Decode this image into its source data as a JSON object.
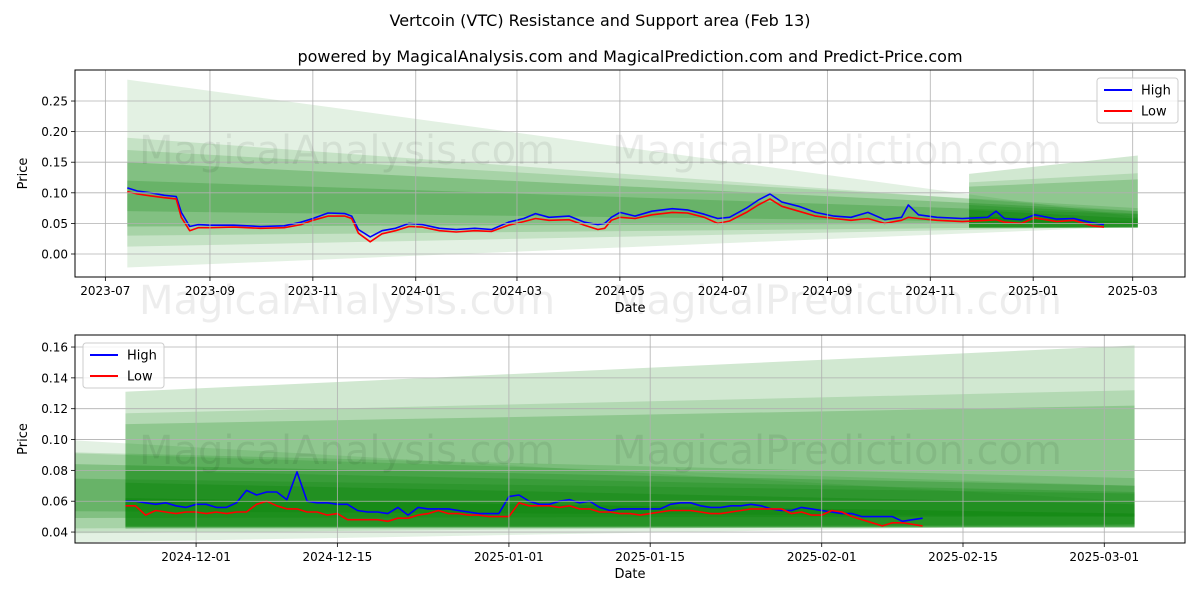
{
  "title": "Vertcoin (VTC) Resistance and Support area (Feb 13)",
  "subtitle": "powered by MagicalAnalysis.com and MagicalPrediction.com and Predict-Price.com",
  "watermarks": [
    "MagicalAnalysis.com",
    "MagicalPrediction.com"
  ],
  "colors": {
    "high": "#0000ff",
    "low": "#ff0000",
    "band": "#008000",
    "grid": "#b0b0b0"
  },
  "chart_data": [
    {
      "type": "line",
      "xlabel": "Date",
      "ylabel": "Price",
      "xlim": [
        "2023-06-13",
        "2025-04-01"
      ],
      "ylim": [
        -0.0376,
        0.3007
      ],
      "grid": true,
      "legend": "top-right",
      "xticks": [
        "2023-07",
        "2023-09",
        "2023-11",
        "2024-01",
        "2024-03",
        "2024-05",
        "2024-07",
        "2024-09",
        "2024-11",
        "2025-01",
        "2025-03"
      ],
      "yticks": [
        "0.00",
        "0.05",
        "0.10",
        "0.15",
        "0.20",
        "0.25"
      ],
      "bands": [
        {
          "start": "2023-07-14",
          "end": "2025-03-04",
          "lo": [
            -0.022,
            0.045
          ],
          "hi": [
            0.285,
            0.06
          ],
          "opacity": 0.11
        },
        {
          "start": "2023-07-14",
          "end": "2025-03-04",
          "lo": [
            0.012,
            0.045
          ],
          "hi": [
            0.19,
            0.07
          ],
          "opacity": 0.13
        },
        {
          "start": "2023-07-14",
          "end": "2025-03-04",
          "lo": [
            0.03,
            0.045
          ],
          "hi": [
            0.17,
            0.075
          ],
          "opacity": 0.15
        },
        {
          "start": "2023-07-14",
          "end": "2025-03-04",
          "lo": [
            0.045,
            0.05
          ],
          "hi": [
            0.15,
            0.07
          ],
          "opacity": 0.22
        },
        {
          "start": "2023-07-14",
          "end": "2025-03-04",
          "lo": [
            0.07,
            0.05
          ],
          "hi": [
            0.12,
            0.065
          ],
          "opacity": 0.2
        },
        {
          "start": "2024-11-24",
          "end": "2025-03-04",
          "lo": [
            0.042,
            0.043
          ],
          "hi": [
            0.131,
            0.161
          ],
          "opacity": 0.18
        },
        {
          "start": "2024-11-24",
          "end": "2025-03-04",
          "lo": [
            0.043,
            0.043
          ],
          "hi": [
            0.117,
            0.132
          ],
          "opacity": 0.14
        },
        {
          "start": "2024-11-24",
          "end": "2025-03-04",
          "lo": [
            0.043,
            0.043
          ],
          "hi": [
            0.11,
            0.122
          ],
          "opacity": 0.2
        },
        {
          "start": "2024-11-24",
          "end": "2025-03-04",
          "lo": [
            0.043,
            0.043
          ],
          "hi": [
            0.08,
            0.066
          ],
          "opacity": 0.2
        },
        {
          "start": "2024-11-24",
          "end": "2025-03-04",
          "lo": [
            0.043,
            0.043
          ],
          "hi": [
            0.072,
            0.058
          ],
          "opacity": 0.25
        },
        {
          "start": "2024-11-24",
          "end": "2025-03-04",
          "lo": [
            0.044,
            0.044
          ],
          "hi": [
            0.062,
            0.052
          ],
          "opacity": 0.3
        }
      ],
      "x": [
        "2023-07-14",
        "2023-07-20",
        "2023-07-28",
        "2023-08-05",
        "2023-08-12",
        "2023-08-15",
        "2023-08-20",
        "2023-08-25",
        "2023-09-01",
        "2023-09-15",
        "2023-10-01",
        "2023-10-15",
        "2023-10-25",
        "2023-11-01",
        "2023-11-10",
        "2023-11-20",
        "2023-11-24",
        "2023-11-28",
        "2023-12-05",
        "2023-12-12",
        "2023-12-20",
        "2023-12-28",
        "2024-01-05",
        "2024-01-15",
        "2024-01-25",
        "2024-02-05",
        "2024-02-15",
        "2024-02-25",
        "2024-03-05",
        "2024-03-12",
        "2024-03-20",
        "2024-04-01",
        "2024-04-10",
        "2024-04-18",
        "2024-04-22",
        "2024-04-26",
        "2024-05-01",
        "2024-05-10",
        "2024-05-20",
        "2024-06-01",
        "2024-06-10",
        "2024-06-20",
        "2024-06-28",
        "2024-07-05",
        "2024-07-15",
        "2024-07-22",
        "2024-07-29",
        "2024-08-05",
        "2024-08-15",
        "2024-08-25",
        "2024-09-05",
        "2024-09-15",
        "2024-09-25",
        "2024-10-05",
        "2024-10-15",
        "2024-10-19",
        "2024-10-25",
        "2024-11-05",
        "2024-11-20",
        "2024-12-05",
        "2024-12-10",
        "2024-12-15",
        "2024-12-25",
        "2025-01-02",
        "2025-01-15",
        "2025-01-25",
        "2025-02-05",
        "2025-02-12"
      ],
      "series": [
        {
          "name": "High",
          "values": [
            0.108,
            0.103,
            0.1,
            0.096,
            0.094,
            0.068,
            0.045,
            0.048,
            0.047,
            0.047,
            0.045,
            0.046,
            0.052,
            0.058,
            0.067,
            0.066,
            0.062,
            0.04,
            0.028,
            0.038,
            0.042,
            0.05,
            0.048,
            0.042,
            0.04,
            0.042,
            0.04,
            0.052,
            0.058,
            0.066,
            0.06,
            0.062,
            0.052,
            0.048,
            0.05,
            0.06,
            0.068,
            0.062,
            0.07,
            0.074,
            0.072,
            0.065,
            0.058,
            0.06,
            0.075,
            0.088,
            0.098,
            0.085,
            0.078,
            0.068,
            0.062,
            0.06,
            0.068,
            0.056,
            0.06,
            0.08,
            0.064,
            0.06,
            0.058,
            0.06,
            0.07,
            0.058,
            0.056,
            0.064,
            0.057,
            0.058,
            0.051,
            0.048
          ]
        },
        {
          "name": "Low",
          "values": [
            0.102,
            0.098,
            0.095,
            0.092,
            0.09,
            0.06,
            0.038,
            0.043,
            0.043,
            0.044,
            0.042,
            0.043,
            0.048,
            0.055,
            0.062,
            0.062,
            0.058,
            0.034,
            0.02,
            0.033,
            0.038,
            0.045,
            0.044,
            0.038,
            0.036,
            0.038,
            0.037,
            0.047,
            0.053,
            0.058,
            0.055,
            0.056,
            0.047,
            0.04,
            0.042,
            0.055,
            0.06,
            0.058,
            0.064,
            0.068,
            0.067,
            0.06,
            0.05,
            0.054,
            0.068,
            0.08,
            0.09,
            0.078,
            0.07,
            0.062,
            0.058,
            0.055,
            0.058,
            0.05,
            0.055,
            0.06,
            0.058,
            0.055,
            0.053,
            0.055,
            0.056,
            0.052,
            0.05,
            0.059,
            0.053,
            0.055,
            0.046,
            0.044
          ]
        }
      ]
    },
    {
      "type": "line",
      "xlabel": "Date",
      "ylabel": "Price",
      "xlim": [
        "2024-11-19",
        "2025-03-09"
      ],
      "ylim": [
        0.0329,
        0.1678
      ],
      "grid": true,
      "legend": "top-left",
      "xticks": [
        "2024-12-01",
        "2024-12-15",
        "2025-01-01",
        "2025-01-15",
        "2025-02-01",
        "2025-02-15",
        "2025-03-01"
      ],
      "yticks": [
        "0.04",
        "0.06",
        "0.08",
        "0.10",
        "0.12",
        "0.14",
        "0.16"
      ],
      "x_start": "2024-11-24",
      "x_step_days": 1,
      "series": [
        {
          "name": "High",
          "values": [
            0.06,
            0.06,
            0.059,
            0.058,
            0.059,
            0.057,
            0.056,
            0.058,
            0.058,
            0.056,
            0.056,
            0.059,
            0.067,
            0.064,
            0.066,
            0.066,
            0.061,
            0.079,
            0.06,
            0.059,
            0.059,
            0.058,
            0.058,
            0.054,
            0.053,
            0.053,
            0.052,
            0.056,
            0.051,
            0.056,
            0.055,
            0.055,
            0.055,
            0.054,
            0.053,
            0.052,
            0.052,
            0.052,
            0.063,
            0.064,
            0.06,
            0.058,
            0.058,
            0.06,
            0.061,
            0.059,
            0.06,
            0.056,
            0.054,
            0.055,
            0.055,
            0.055,
            0.055,
            0.055,
            0.058,
            0.059,
            0.059,
            0.057,
            0.056,
            0.056,
            0.057,
            0.057,
            0.058,
            0.057,
            0.055,
            0.054,
            0.054,
            0.056,
            0.055,
            0.054,
            0.053,
            0.052,
            0.052,
            0.05,
            0.05,
            0.05,
            0.05,
            0.047,
            0.048,
            0.049
          ]
        },
        {
          "name": "Low",
          "values": [
            0.057,
            0.057,
            0.051,
            0.054,
            0.053,
            0.052,
            0.053,
            0.053,
            0.052,
            0.053,
            0.052,
            0.053,
            0.053,
            0.058,
            0.06,
            0.057,
            0.055,
            0.055,
            0.053,
            0.053,
            0.051,
            0.052,
            0.048,
            0.048,
            0.048,
            0.048,
            0.047,
            0.049,
            0.049,
            0.051,
            0.052,
            0.054,
            0.052,
            0.052,
            0.051,
            0.051,
            0.05,
            0.05,
            0.05,
            0.059,
            0.057,
            0.057,
            0.057,
            0.056,
            0.057,
            0.055,
            0.055,
            0.053,
            0.053,
            0.052,
            0.052,
            0.051,
            0.052,
            0.053,
            0.054,
            0.054,
            0.054,
            0.053,
            0.052,
            0.052,
            0.053,
            0.054,
            0.055,
            0.055,
            0.055,
            0.055,
            0.052,
            0.053,
            0.051,
            0.051,
            0.054,
            0.053,
            0.05,
            0.048,
            0.046,
            0.044,
            0.046,
            0.046,
            0.045,
            0.044
          ]
        }
      ]
    }
  ]
}
